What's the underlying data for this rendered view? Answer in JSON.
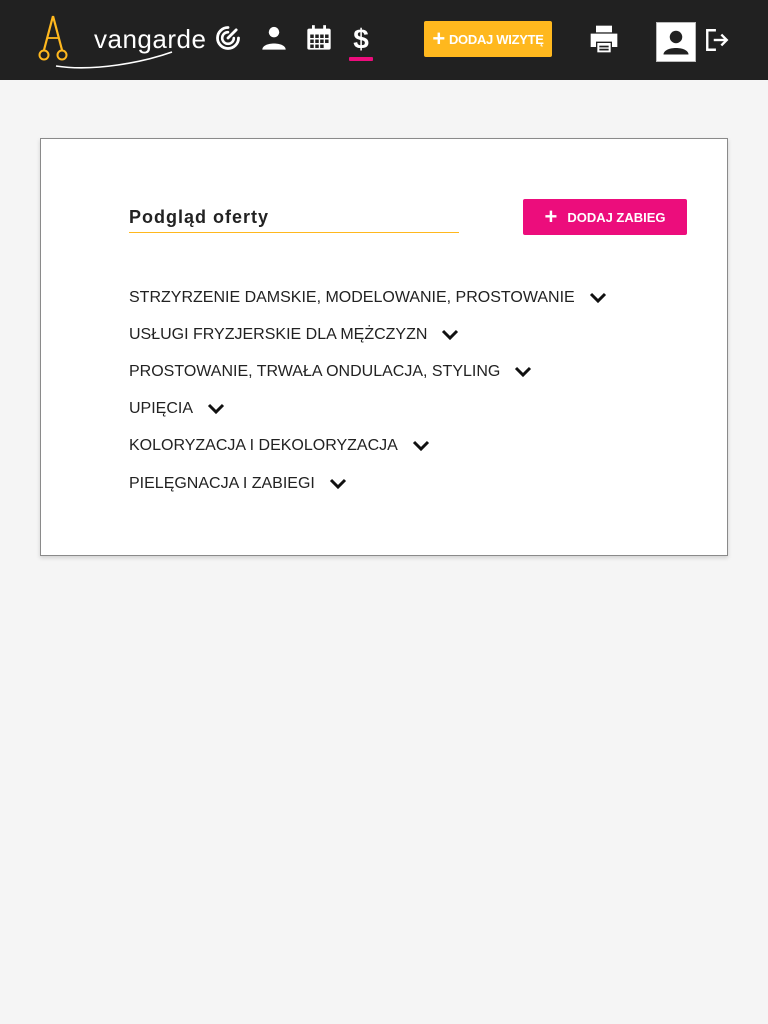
{
  "brand": {
    "logo_text": "vangarde",
    "logo_letter": "A",
    "accent": "#ffb81e",
    "highlight": "#ec0d7c"
  },
  "nav": {
    "items": [
      {
        "name": "dashboard",
        "icon": "speedometer-icon",
        "active": false
      },
      {
        "name": "clients",
        "icon": "person-icon",
        "active": false
      },
      {
        "name": "calendar",
        "icon": "calendar-icon",
        "active": false
      },
      {
        "name": "pricing",
        "icon": "dollar-icon",
        "active": true
      }
    ],
    "add_visit_label": "DODAJ WIZYTĘ",
    "print_icon": "printer-icon",
    "user_icon": "account-box-icon",
    "logout_icon": "logout-icon"
  },
  "offer": {
    "title": "Podgląd oferty",
    "add_treatment_label": "DODAJ ZABIEG",
    "categories": [
      {
        "label": "STRZYRZENIE DAMSKIE, MODELOWANIE, PROSTOWANIE"
      },
      {
        "label": "USŁUGI FRYZJERSKIE DLA MĘŻCZYZN"
      },
      {
        "label": "PROSTOWANIE, TRWAŁA ONDULACJA, STYLING"
      },
      {
        "label": "UPIĘCIA"
      },
      {
        "label": "KOLORYZACJA I DEKOLORYZACJA"
      },
      {
        "label": "PIELĘGNACJA I ZABIEGI"
      }
    ]
  }
}
